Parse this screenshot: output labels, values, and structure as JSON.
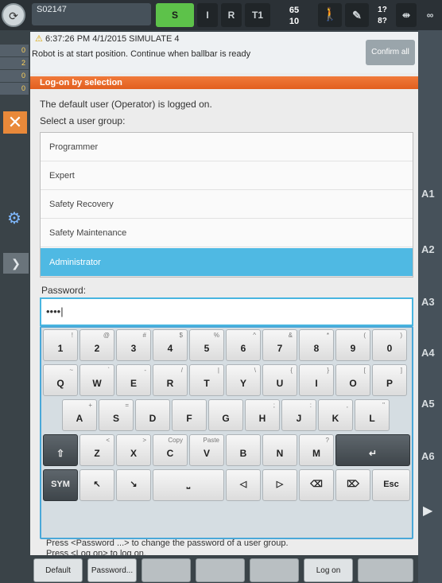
{
  "header": {
    "robot_name": "S02147",
    "modes": [
      "S",
      "I",
      "R",
      "T1"
    ],
    "speed_top": "65",
    "speed_bottom": "10",
    "question_top": "1?",
    "question_bottom": "8?",
    "infinity": "∞"
  },
  "left_rail": {
    "counters": [
      "0",
      "2",
      "0",
      "0"
    ]
  },
  "right_rail": {
    "axes": [
      "A1",
      "A2",
      "A3",
      "A4",
      "A5",
      "A6"
    ]
  },
  "message": {
    "line1": "6:37:26 PM 4/1/2015 SIMULATE 4",
    "line2": "Robot is at start position. Continue when ballbar is ready",
    "confirm_all": "Confirm all"
  },
  "dialog": {
    "title": "Log-on by selection",
    "status": "The default user (Operator) is logged on.",
    "select_prompt": "Select a user group:",
    "groups": [
      "Programmer",
      "Expert",
      "Safety Recovery",
      "Safety Maintenance",
      "Administrator"
    ],
    "password_label": "Password:",
    "password_value": "••••|",
    "hint1": "Press <Password ...> to change the password of a user group.",
    "hint2": "Press <Log on> to log on."
  },
  "keyboard": {
    "row1": [
      {
        "main": "1",
        "alt": "!"
      },
      {
        "main": "2",
        "alt": "@"
      },
      {
        "main": "3",
        "alt": "#"
      },
      {
        "main": "4",
        "alt": "$"
      },
      {
        "main": "5",
        "alt": "%"
      },
      {
        "main": "6",
        "alt": "^"
      },
      {
        "main": "7",
        "alt": "&"
      },
      {
        "main": "8",
        "alt": "*"
      },
      {
        "main": "9",
        "alt": "("
      },
      {
        "main": "0",
        "alt": ")"
      }
    ],
    "row2": [
      {
        "main": "Q",
        "alt": "~"
      },
      {
        "main": "W",
        "alt": "`"
      },
      {
        "main": "E",
        "alt": "-"
      },
      {
        "main": "R",
        "alt": "/"
      },
      {
        "main": "T",
        "alt": "|"
      },
      {
        "main": "Y",
        "alt": "\\"
      },
      {
        "main": "U",
        "alt": "{"
      },
      {
        "main": "I",
        "alt": "}"
      },
      {
        "main": "O",
        "alt": "["
      },
      {
        "main": "P",
        "alt": "]"
      }
    ],
    "row3": [
      {
        "main": "A",
        "alt": "+"
      },
      {
        "main": "S",
        "alt": "="
      },
      {
        "main": "D",
        "alt": ""
      },
      {
        "main": "F",
        "alt": ""
      },
      {
        "main": "G",
        "alt": ""
      },
      {
        "main": "H",
        "alt": ";"
      },
      {
        "main": "J",
        "alt": ":"
      },
      {
        "main": "K",
        "alt": ","
      },
      {
        "main": "L",
        "alt": "\""
      }
    ],
    "row4": [
      {
        "main": "Z",
        "alt": "<"
      },
      {
        "main": "X",
        "alt": ">"
      },
      {
        "main": "C",
        "alt": "Copy"
      },
      {
        "main": "V",
        "alt": "Paste"
      },
      {
        "main": "B",
        "alt": ""
      },
      {
        "main": "N",
        "alt": ""
      },
      {
        "main": "M",
        "alt": "?"
      }
    ],
    "shift": "⇧",
    "enter": "↵",
    "sym": "SYM",
    "arrow_ul": "↖",
    "arrow_dr": "↘",
    "space": "⎵",
    "left": "◁",
    "right": "▷",
    "backspace": "⌫",
    "delete": "⌦",
    "esc": "Esc"
  },
  "footer": {
    "default": "Default",
    "password": "Password...",
    "log_on": "Log on"
  }
}
